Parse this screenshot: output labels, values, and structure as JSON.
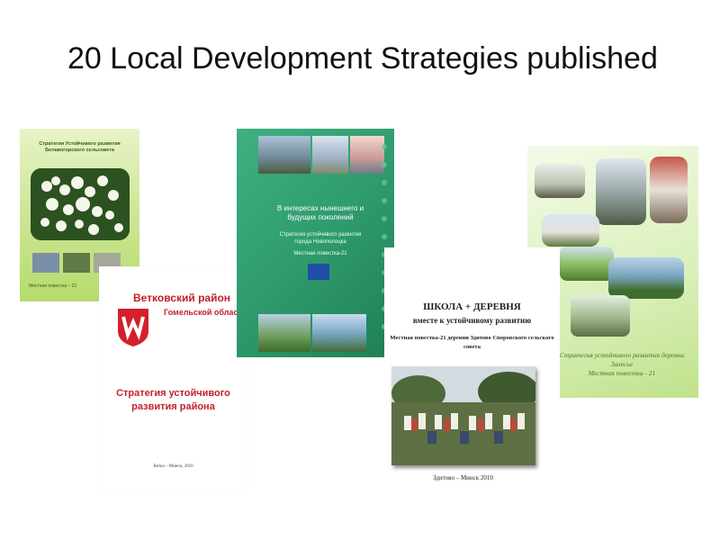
{
  "slide": {
    "title": "20 Local Development Strategies published"
  },
  "covers": {
    "c1": {
      "title": "Стратегия Устойчивого развития Белавогорского сельсовета",
      "bottom": "Местная повестка – 21"
    },
    "c2": {
      "region": "Ветковский район",
      "oblast": "Гомельской облас",
      "subtitle": "Стратегия устойчивого развития района",
      "footer": "Ветка – Минск, 2010"
    },
    "c3": {
      "heading": "В интересах нынешнего и будущих поколений",
      "subtitle": "Стратегия устойчивого развития города Новополоцка",
      "agenda": "Местная повестка-21"
    },
    "c4": {
      "title": "Стратегия устойчивого развития деревни Залесье",
      "agenda": "Местная повестка - 21"
    },
    "c5": {
      "title": "ШКОЛА + ДЕРЕВНЯ",
      "subtitle": "вместе к устойчивому развитию",
      "agenda": "Местная повестка-21 деревни Здитово Споровского сельского совета",
      "footer": "Здитово – Минск 2010"
    }
  }
}
